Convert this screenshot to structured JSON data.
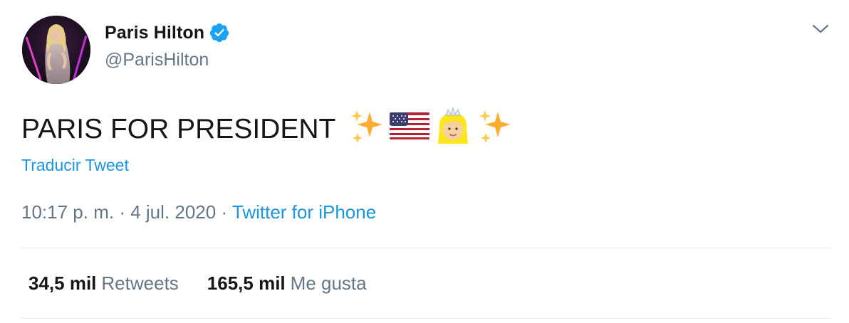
{
  "author": {
    "display_name": "Paris Hilton",
    "handle": "@ParisHilton",
    "verified": true,
    "avatar_icon": "profile-photo"
  },
  "menu": {
    "icon": "chevron-down-icon"
  },
  "tweet": {
    "text": "PARIS FOR PRESIDENT",
    "emojis": [
      "sparkles-emoji",
      "us-flag-emoji",
      "princess-emoji",
      "sparkles-emoji"
    ],
    "translate_label": "Traducir Tweet"
  },
  "meta": {
    "time": "10:17 p. m.",
    "separator1": "·",
    "date": "4 jul. 2020",
    "separator2": "·",
    "source": "Twitter for iPhone"
  },
  "stats": {
    "retweets_count": "34,5 mil",
    "retweets_label": "Retweets",
    "likes_count": "165,5 mil",
    "likes_label": "Me gusta"
  },
  "colors": {
    "link": "#1b95e0",
    "secondary": "#657786",
    "primary_text": "#14171a",
    "divider": "#e6ecf0",
    "verified": "#1da1f2"
  }
}
